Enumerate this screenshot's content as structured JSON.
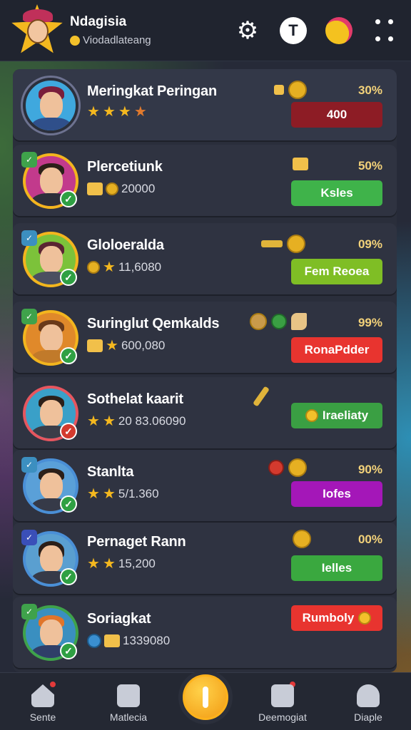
{
  "header": {
    "title": "Ndagisia",
    "subtitle": "Viodadlateang"
  },
  "rows": [
    {
      "name": "Meringkat Peringan",
      "meta_text": "",
      "percent": "30%",
      "button": "400",
      "button_color": "#8d1c25",
      "stars": 4
    },
    {
      "name": "Plercetiunk",
      "meta_text": "20000",
      "percent": "50%",
      "button": "Ksles",
      "button_color": "#3fb34a",
      "stars": 0
    },
    {
      "name": "Gloloeralda",
      "meta_text": "11,6080",
      "percent": "09%",
      "button": "Fem Reoea",
      "button_color": "#7fbe25",
      "stars": 0
    },
    {
      "name": "Suringlut Qemkalds",
      "meta_text": "600,080",
      "percent": "99%",
      "button": "RonaPdder",
      "button_color": "#e8342f",
      "stars": 0
    },
    {
      "name": "Sothelat kaarit",
      "meta_text": "20 83.06090",
      "percent": "",
      "button": "Iraeliaty",
      "button_color": "#3a9f43",
      "stars": 2
    },
    {
      "name": "Stanlta",
      "meta_text": "5/1.360",
      "percent": "90%",
      "button": "Iofes",
      "button_color": "#a417b8",
      "stars": 2
    },
    {
      "name": "Pernaget Rann",
      "meta_text": "15,200",
      "percent": "00%",
      "button": "Ielles",
      "button_color": "#3aa83f",
      "stars": 2
    },
    {
      "name": "Soriagkat",
      "meta_text": "1339080",
      "percent": "",
      "button": "Rumboly",
      "button_color": "#e8342f",
      "stars": 0
    }
  ],
  "nav": [
    {
      "label": "Sente"
    },
    {
      "label": "Matlecia"
    },
    {
      "label": "Deemogiat"
    },
    {
      "label": "Diaple"
    }
  ]
}
